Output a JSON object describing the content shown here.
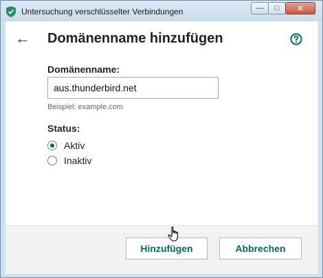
{
  "window": {
    "title": "Untersuchung verschlüsselter Verbindungen",
    "controls": {
      "minimize": "—",
      "maximize": "□",
      "close": "✕"
    }
  },
  "dialog": {
    "heading": "Domänenname hinzufügen",
    "back_icon": "←",
    "domain_label": "Domänenname:",
    "domain_value": "aus.thunderbird.net",
    "example_hint": "Beispiel: example.com",
    "status_label": "Status:",
    "status_options": [
      {
        "label": "Aktiv",
        "checked": true
      },
      {
        "label": "Inaktiv",
        "checked": false
      }
    ]
  },
  "footer": {
    "add_label": "Hinzufügen",
    "cancel_label": "Abbrechen"
  },
  "colors": {
    "accent": "#006d5b",
    "footer_bg": "#f2f2f2",
    "titlebar": "#cfe0ee"
  },
  "icons": {
    "app": "shield-check-icon",
    "help": "question-circle-icon",
    "back": "arrow-left-icon",
    "cursor": "hand-pointer-icon"
  }
}
